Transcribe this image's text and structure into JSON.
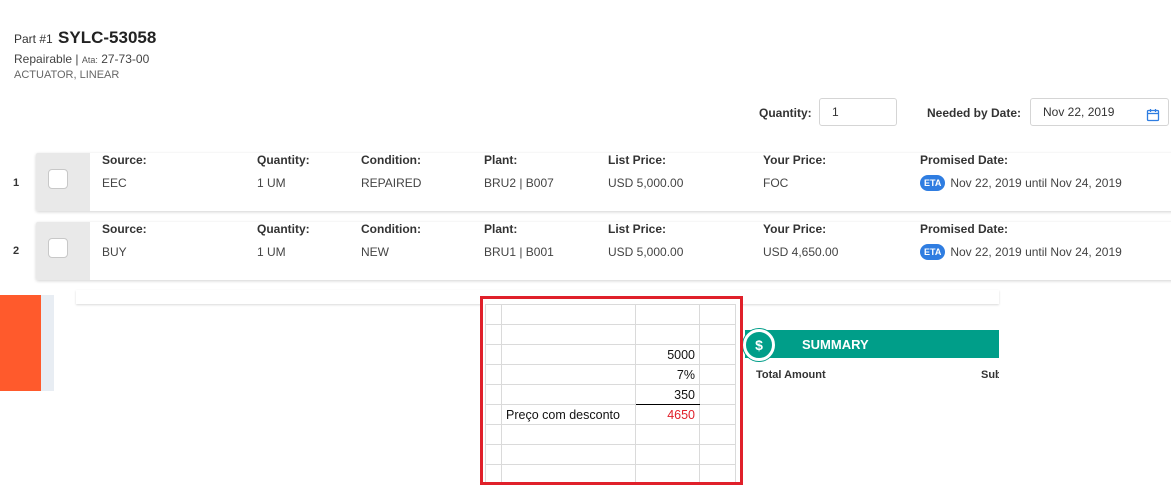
{
  "part": {
    "prefix": "Part #1",
    "number": "SYLC-53058",
    "status": "Repairable |",
    "ata_label": "Ata:",
    "ata_value": "27-73-00",
    "description": "ACTUATOR, LINEAR"
  },
  "controls": {
    "quantity_label": "Quantity:",
    "quantity_value": "1",
    "needed_label": "Needed by Date:",
    "needed_value": "Nov 22, 2019"
  },
  "offers": [
    {
      "index": "1",
      "source_h": "Source:",
      "source": "EEC",
      "qty_h": "Quantity:",
      "qty": "1 UM",
      "cond_h": "Condition:",
      "cond": "REPAIRED",
      "plant_h": "Plant:",
      "plant": "BRU2 | B007",
      "list_h": "List Price:",
      "list": "USD 5,000.00",
      "your_h": "Your Price:",
      "your": "FOC",
      "prom_h": "Promised Date:",
      "eta": "ETA",
      "prom": "Nov 22, 2019 until Nov 24, 2019"
    },
    {
      "index": "2",
      "source_h": "Source:",
      "source": "BUY",
      "qty_h": "Quantity:",
      "qty": "1 UM",
      "cond_h": "Condition:",
      "cond": "NEW",
      "plant_h": "Plant:",
      "plant": "BRU1 | B001",
      "list_h": "List Price:",
      "list": "USD 5,000.00",
      "your_h": "Your Price:",
      "your": "USD 4,650.00",
      "prom_h": "Promised Date:",
      "eta": "ETA",
      "prom": "Nov 22, 2019 until Nov 24, 2019"
    }
  ],
  "sheet": {
    "v1": "5000",
    "v2": "7%",
    "v3": "350",
    "result_label": "Preço com desconto",
    "result": "4650"
  },
  "summary": {
    "icon": "dollar-icon",
    "title": "SUMMARY",
    "total_label": "Total Amount",
    "sub_label": "Sub"
  },
  "colors": {
    "eta_badge": "#2f7de1",
    "summary": "#009e89",
    "highlight_box": "#e0202a",
    "orange_bar": "#ff5a2c"
  }
}
